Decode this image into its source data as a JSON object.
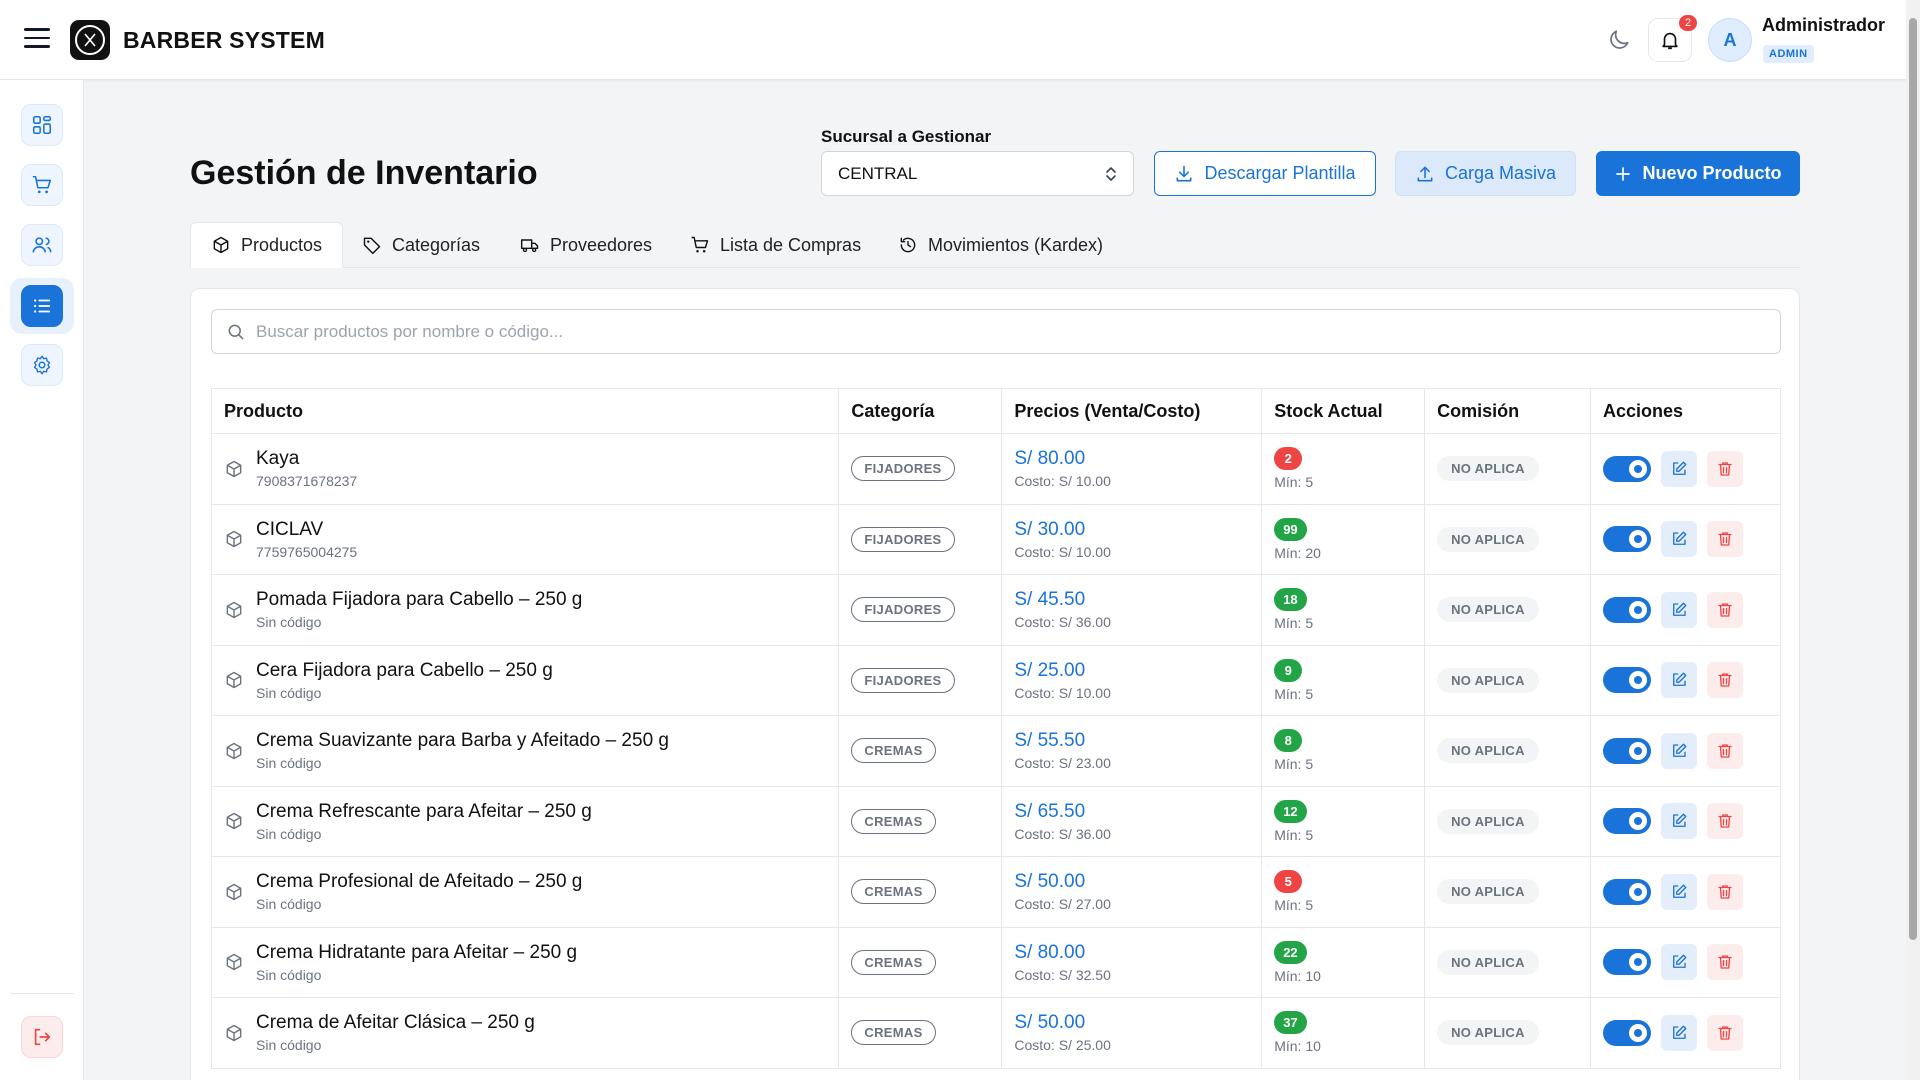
{
  "app": {
    "brand": "BARBER SYSTEM",
    "notifications": "2"
  },
  "user": {
    "name": "Administrador",
    "role": "ADMIN",
    "initial": "A"
  },
  "page": {
    "title": "Gestión de Inventario",
    "branch_label": "Sucursal a Gestionar",
    "branch_value": "CENTRAL",
    "btn_download": "Descargar Plantilla",
    "btn_bulk": "Carga Masiva",
    "btn_new": "Nuevo Producto"
  },
  "tabs": [
    {
      "label": "Productos",
      "icon": "box-icon"
    },
    {
      "label": "Categorías",
      "icon": "tag-icon"
    },
    {
      "label": "Proveedores",
      "icon": "truck-icon"
    },
    {
      "label": "Lista de Compras",
      "icon": "cart-icon"
    },
    {
      "label": "Movimientos (Kardex)",
      "icon": "history-icon"
    }
  ],
  "search": {
    "placeholder": "Buscar productos por nombre o código..."
  },
  "table": {
    "headers": [
      "Producto",
      "Categoría",
      "Precios (Venta/Costo)",
      "Stock Actual",
      "Comisión",
      "Acciones"
    ],
    "rows": [
      {
        "name": "Kaya",
        "code": "7908371678237",
        "category": "FIJADORES",
        "price": "S/ 80.00",
        "cost": "Costo: S/ 10.00",
        "stock": "2",
        "min": "Mín: 5",
        "stock_status": "low",
        "commission": "NO APLICA"
      },
      {
        "name": "CICLAV",
        "code": "7759765004275",
        "category": "FIJADORES",
        "price": "S/ 30.00",
        "cost": "Costo: S/ 10.00",
        "stock": "99",
        "min": "Mín: 20",
        "stock_status": "ok",
        "commission": "NO APLICA"
      },
      {
        "name": "Pomada Fijadora para Cabello – 250 g",
        "code": "Sin código",
        "category": "FIJADORES",
        "price": "S/ 45.50",
        "cost": "Costo: S/ 36.00",
        "stock": "18",
        "min": "Mín: 5",
        "stock_status": "ok",
        "commission": "NO APLICA"
      },
      {
        "name": "Cera Fijadora para Cabello – 250 g",
        "code": "Sin código",
        "category": "FIJADORES",
        "price": "S/ 25.00",
        "cost": "Costo: S/ 10.00",
        "stock": "9",
        "min": "Mín: 5",
        "stock_status": "ok",
        "commission": "NO APLICA"
      },
      {
        "name": "Crema Suavizante para Barba y Afeitado – 250 g",
        "code": "Sin código",
        "category": "CREMAS",
        "price": "S/ 55.50",
        "cost": "Costo: S/ 23.00",
        "stock": "8",
        "min": "Mín: 5",
        "stock_status": "ok",
        "commission": "NO APLICA"
      },
      {
        "name": "Crema Refrescante para Afeitar – 250 g",
        "code": "Sin código",
        "category": "CREMAS",
        "price": "S/ 65.50",
        "cost": "Costo: S/ 36.00",
        "stock": "12",
        "min": "Mín: 5",
        "stock_status": "ok",
        "commission": "NO APLICA"
      },
      {
        "name": "Crema Profesional de Afeitado – 250 g",
        "code": "Sin código",
        "category": "CREMAS",
        "price": "S/ 50.00",
        "cost": "Costo: S/ 27.00",
        "stock": "5",
        "min": "Mín: 5",
        "stock_status": "low",
        "commission": "NO APLICA"
      },
      {
        "name": "Crema Hidratante para Afeitar – 250 g",
        "code": "Sin código",
        "category": "CREMAS",
        "price": "S/ 80.00",
        "cost": "Costo: S/ 32.50",
        "stock": "22",
        "min": "Mín: 10",
        "stock_status": "ok",
        "commission": "NO APLICA"
      },
      {
        "name": "Crema de Afeitar Clásica – 250 g",
        "code": "Sin código",
        "category": "CREMAS",
        "price": "S/ 50.00",
        "cost": "Costo: S/ 25.00",
        "stock": "37",
        "min": "Mín: 10",
        "stock_status": "ok",
        "commission": "NO APLICA"
      }
    ]
  },
  "colors": {
    "accent": "#1a73d9",
    "stock_low": "#ef4444",
    "stock_ok": "#22a447",
    "danger": "#ef4444"
  }
}
